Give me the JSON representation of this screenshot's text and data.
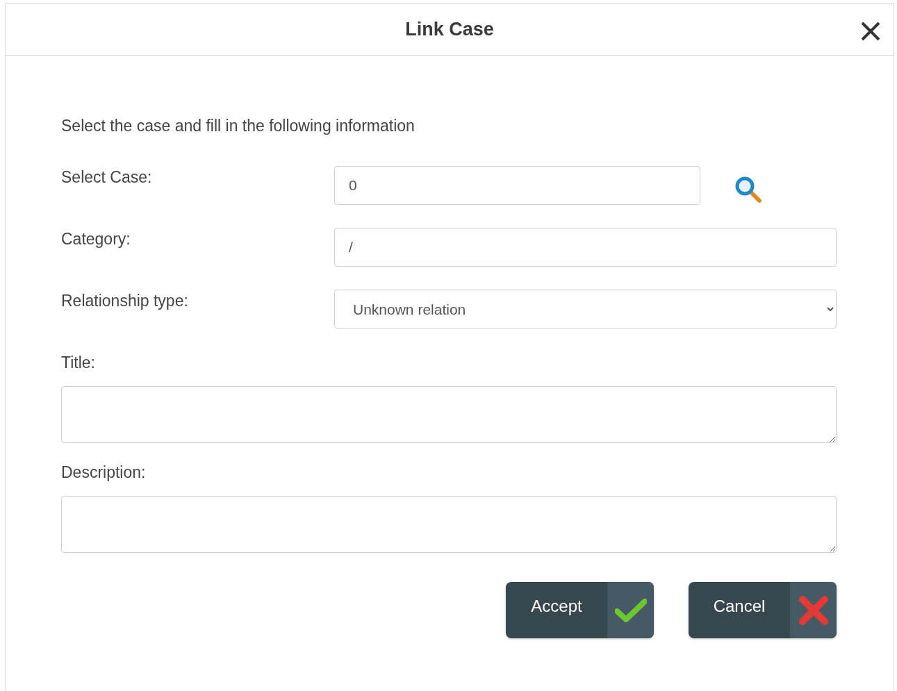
{
  "dialog": {
    "title": "Link Case"
  },
  "intro": "Select the case and fill in the following information",
  "fields": [
    {
      "kind": "input",
      "label": "Select Case:",
      "value": "0",
      "search": true
    },
    {
      "kind": "input",
      "label": "Category:",
      "value": "/",
      "search": false
    },
    {
      "kind": "select",
      "label": "Relationship type:",
      "value": "Unknown relation"
    },
    {
      "kind": "textarea",
      "label": "Title:"
    },
    {
      "kind": "textarea",
      "label": "Description:"
    }
  ],
  "buttons": [
    {
      "kind": "accept",
      "label": "Accept"
    },
    {
      "kind": "cancel",
      "label": "Cancel"
    }
  ]
}
